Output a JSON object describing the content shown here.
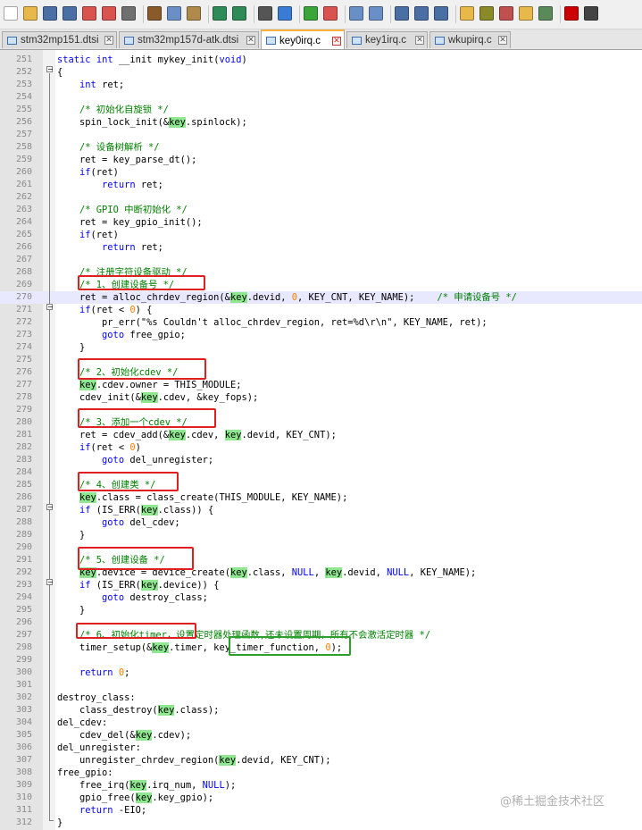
{
  "toolbar": {
    "buttons": [
      {
        "name": "new-file-icon",
        "color": "#ffffff"
      },
      {
        "name": "open-file-icon",
        "color": "#e8b84a"
      },
      {
        "name": "save-icon",
        "color": "#4a6fa5"
      },
      {
        "name": "save-all-icon",
        "color": "#4a6fa5"
      },
      {
        "name": "close-file-icon",
        "color": "#d9534f"
      },
      {
        "name": "close-all-icon",
        "color": "#d9534f"
      },
      {
        "name": "print-icon",
        "color": "#707070"
      },
      {
        "name": "cut-icon",
        "color": "#8a5a2b"
      },
      {
        "name": "copy-icon",
        "color": "#6a8fc7"
      },
      {
        "name": "paste-icon",
        "color": "#b08a4a"
      },
      {
        "name": "undo-icon",
        "color": "#2e8b57"
      },
      {
        "name": "redo-icon",
        "color": "#2e8b57"
      },
      {
        "name": "find-icon",
        "color": "#555555"
      },
      {
        "name": "replace-icon",
        "color": "#3a7bd5"
      },
      {
        "name": "zoom-in-icon",
        "color": "#3aa63a"
      },
      {
        "name": "zoom-out-icon",
        "color": "#d9534f"
      },
      {
        "name": "sync-vertical-icon",
        "color": "#6a8fc7"
      },
      {
        "name": "sync-horizontal-icon",
        "color": "#6a8fc7"
      },
      {
        "name": "word-wrap-icon",
        "color": "#4a6fa5"
      },
      {
        "name": "show-all-chars-icon",
        "color": "#4a6fa5"
      },
      {
        "name": "indent-guide-icon",
        "color": "#4a6fa5"
      },
      {
        "name": "user-language-icon",
        "color": "#e8b84a"
      },
      {
        "name": "document-map-icon",
        "color": "#8a8a2b"
      },
      {
        "name": "function-list-icon",
        "color": "#c0504d"
      },
      {
        "name": "folder-workspace-icon",
        "color": "#e8b84a"
      },
      {
        "name": "monitoring-icon",
        "color": "#5a8a5a"
      },
      {
        "name": "record-macro-icon",
        "color": "#cc0000"
      },
      {
        "name": "stop-macro-icon",
        "color": "#444444"
      }
    ]
  },
  "tabs": [
    {
      "label": "stm32mp151.dtsi",
      "active": false
    },
    {
      "label": "stm32mp157d-atk.dtsi",
      "active": false
    },
    {
      "label": "key0irq.c",
      "active": true
    },
    {
      "label": "key1irq.c",
      "active": false
    },
    {
      "label": "wkupirq.c",
      "active": false
    }
  ],
  "editor": {
    "current_line": 270,
    "lines": [
      {
        "n": "251",
        "code": "static int __init mykey_init(void)"
      },
      {
        "n": "252",
        "code": "{"
      },
      {
        "n": "253",
        "code": "    int ret;"
      },
      {
        "n": "254",
        "code": ""
      },
      {
        "n": "255",
        "code": "    /* 初始化自旋锁 */"
      },
      {
        "n": "256",
        "code": "    spin_lock_init(&key.spinlock);"
      },
      {
        "n": "257",
        "code": ""
      },
      {
        "n": "258",
        "code": "    /* 设备树解析 */"
      },
      {
        "n": "259",
        "code": "    ret = key_parse_dt();"
      },
      {
        "n": "260",
        "code": "    if(ret)"
      },
      {
        "n": "261",
        "code": "        return ret;"
      },
      {
        "n": "262",
        "code": ""
      },
      {
        "n": "263",
        "code": "    /* GPIO 中断初始化 */"
      },
      {
        "n": "264",
        "code": "    ret = key_gpio_init();"
      },
      {
        "n": "265",
        "code": "    if(ret)"
      },
      {
        "n": "266",
        "code": "        return ret;"
      },
      {
        "n": "267",
        "code": ""
      },
      {
        "n": "268",
        "code": "    /* 注册字符设备驱动 */"
      },
      {
        "n": "269",
        "code": "    /* 1、创建设备号 */"
      },
      {
        "n": "270",
        "code": "    ret = alloc_chrdev_region(&key.devid, 0, KEY_CNT, KEY_NAME);    /* 申请设备号 */"
      },
      {
        "n": "271",
        "code": "    if(ret < 0) {"
      },
      {
        "n": "272",
        "code": "        pr_err(\"%s Couldn't alloc_chrdev_region, ret=%d\\r\\n\", KEY_NAME, ret);"
      },
      {
        "n": "273",
        "code": "        goto free_gpio;"
      },
      {
        "n": "274",
        "code": "    }"
      },
      {
        "n": "275",
        "code": ""
      },
      {
        "n": "276",
        "code": "    /* 2、初始化cdev */"
      },
      {
        "n": "277",
        "code": "    key.cdev.owner = THIS_MODULE;"
      },
      {
        "n": "278",
        "code": "    cdev_init(&key.cdev, &key_fops);"
      },
      {
        "n": "279",
        "code": ""
      },
      {
        "n": "280",
        "code": "    /* 3、添加一个cdev */"
      },
      {
        "n": "281",
        "code": "    ret = cdev_add(&key.cdev, key.devid, KEY_CNT);"
      },
      {
        "n": "282",
        "code": "    if(ret < 0)"
      },
      {
        "n": "283",
        "code": "        goto del_unregister;"
      },
      {
        "n": "284",
        "code": ""
      },
      {
        "n": "285",
        "code": "    /* 4、创建类 */"
      },
      {
        "n": "286",
        "code": "    key.class = class_create(THIS_MODULE, KEY_NAME);"
      },
      {
        "n": "287",
        "code": "    if (IS_ERR(key.class)) {"
      },
      {
        "n": "288",
        "code": "        goto del_cdev;"
      },
      {
        "n": "289",
        "code": "    }"
      },
      {
        "n": "290",
        "code": ""
      },
      {
        "n": "291",
        "code": "    /* 5、创建设备 */"
      },
      {
        "n": "292",
        "code": "    key.device = device_create(key.class, NULL, key.devid, NULL, KEY_NAME);"
      },
      {
        "n": "293",
        "code": "    if (IS_ERR(key.device)) {"
      },
      {
        "n": "294",
        "code": "        goto destroy_class;"
      },
      {
        "n": "295",
        "code": "    }"
      },
      {
        "n": "296",
        "code": ""
      },
      {
        "n": "297",
        "code": "    /* 6、初始化timer，设置定时器处理函数,还未设置周期，所有不会激活定时器 */"
      },
      {
        "n": "298",
        "code": "    timer_setup(&key.timer, key_timer_function, 0);"
      },
      {
        "n": "299",
        "code": ""
      },
      {
        "n": "300",
        "code": "    return 0;"
      },
      {
        "n": "301",
        "code": ""
      },
      {
        "n": "302",
        "code": "destroy_class:"
      },
      {
        "n": "303",
        "code": "    class_destroy(key.class);"
      },
      {
        "n": "304",
        "code": "del_cdev:"
      },
      {
        "n": "305",
        "code": "    cdev_del(&key.cdev);"
      },
      {
        "n": "306",
        "code": "del_unregister:"
      },
      {
        "n": "307",
        "code": "    unregister_chrdev_region(key.devid, KEY_CNT);"
      },
      {
        "n": "308",
        "code": "free_gpio:"
      },
      {
        "n": "309",
        "code": "    free_irq(key.irq_num, NULL);"
      },
      {
        "n": "310",
        "code": "    gpio_free(key.key_gpio);"
      },
      {
        "n": "311",
        "code": "    return -EIO;"
      },
      {
        "n": "312",
        "code": "}"
      }
    ]
  },
  "watermark": "@稀土掘金技术社区"
}
